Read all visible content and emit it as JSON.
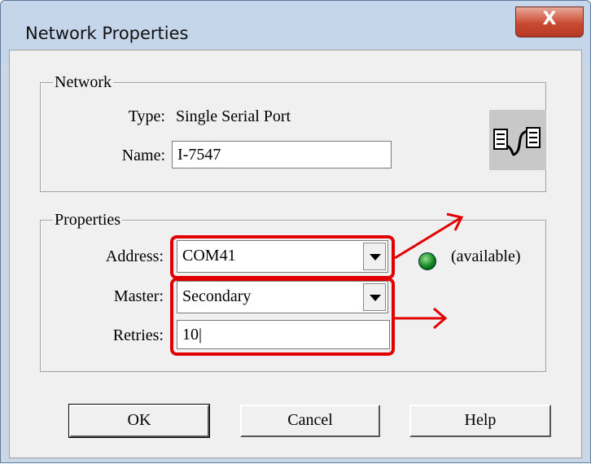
{
  "window": {
    "title": "Network Properties",
    "close_label": "X"
  },
  "network_group": {
    "legend": "Network",
    "type_label": "Type:",
    "type_value": "Single Serial Port",
    "name_label": "Name:",
    "name_value": "I-7547",
    "icon": "serial-port-icon"
  },
  "properties_group": {
    "legend": "Properties",
    "address_label": "Address:",
    "address_value": "COM41",
    "status_text": "(available)",
    "status_color": "#0b7d1a",
    "master_label": "Master:",
    "master_value": "Secondary",
    "retries_label": "Retries:",
    "retries_value": "10|"
  },
  "buttons": {
    "ok": "OK",
    "cancel": "Cancel",
    "help": "Help"
  },
  "annotation_color": "#e00000"
}
